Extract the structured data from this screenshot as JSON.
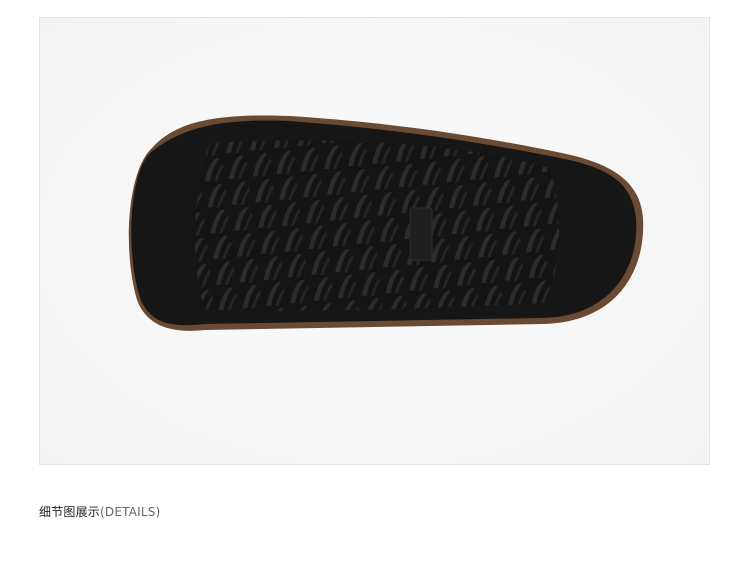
{
  "image": {
    "subject": "shoe-sole-photo",
    "colors": {
      "background": "#f3f3f3",
      "sole": "#161616",
      "cork_edge": "#6b4a33",
      "tread": "#262626"
    }
  },
  "caption": {
    "title_cn": "细节图展示",
    "title_en": "(DETAILS)"
  }
}
